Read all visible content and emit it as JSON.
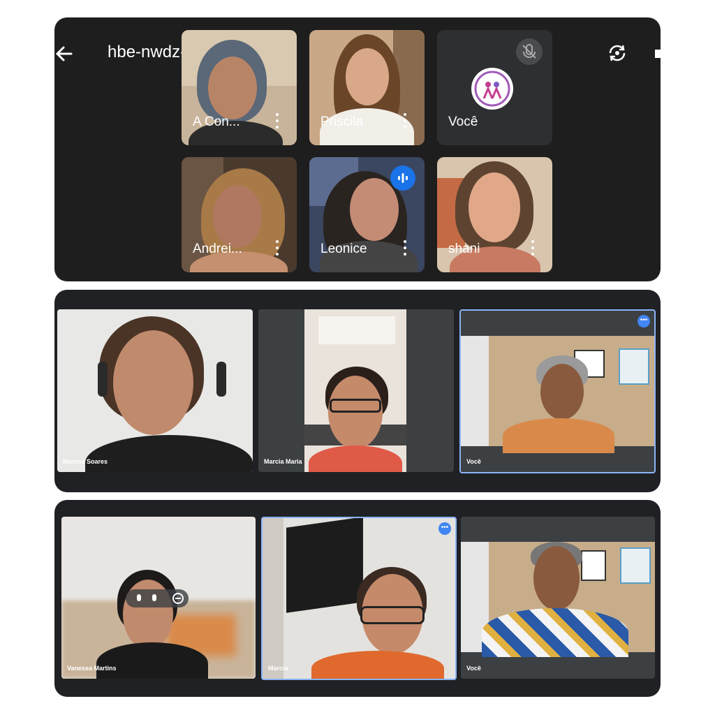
{
  "top_call": {
    "meeting_code": "hbe-nwdz-xig",
    "participants": [
      {
        "name": "A Con..."
      },
      {
        "name": "Priscila"
      },
      {
        "name": "Você"
      },
      {
        "name": "Andrei..."
      },
      {
        "name": "Leonice"
      },
      {
        "name": "shani"
      }
    ]
  },
  "middle_call": {
    "participants": [
      {
        "name": "Marcos Soares"
      },
      {
        "name": "Marcia Maria"
      },
      {
        "name": "Você"
      }
    ]
  },
  "bottom_call": {
    "participants": [
      {
        "name": "Vanessa Martins"
      },
      {
        "name": "Marcia"
      },
      {
        "name": "Você"
      }
    ]
  },
  "icons": {
    "back": "back-arrow-icon",
    "chevron": "chevron-right-icon",
    "switch_camera": "switch-camera-icon",
    "mic_off": "mic-off-icon",
    "speaking": "speaking-indicator-icon"
  },
  "colors": {
    "panel_bg": "#1f1f1f",
    "accent_blue": "#4285f4",
    "speaking_blue": "#1a73e8"
  }
}
